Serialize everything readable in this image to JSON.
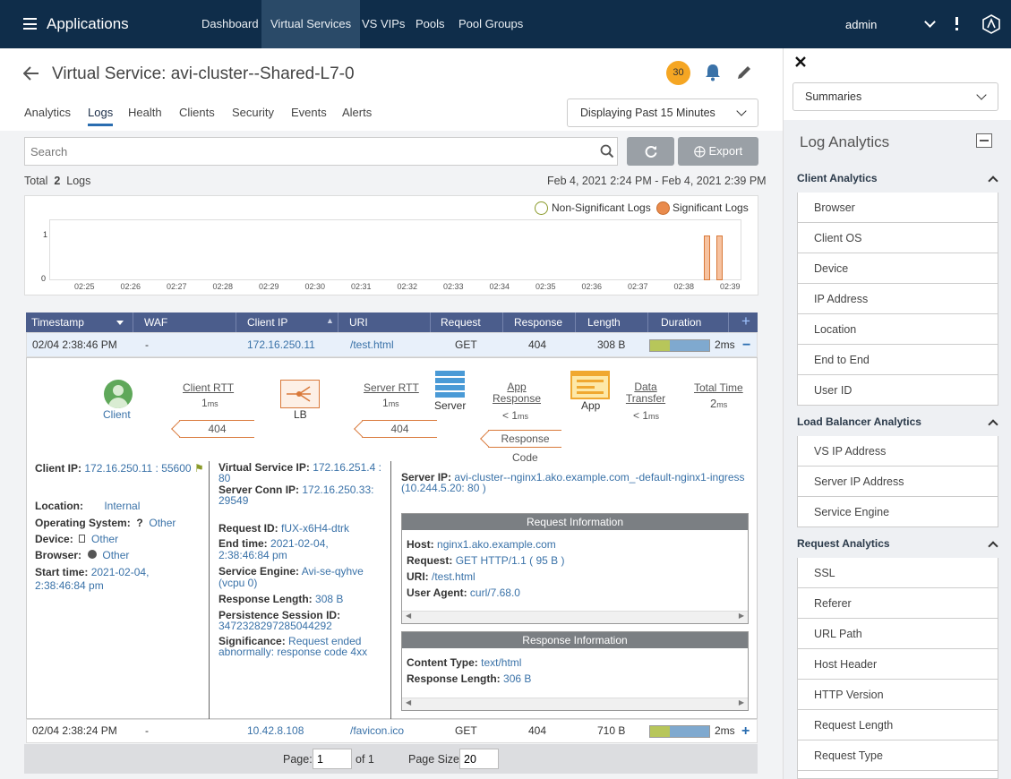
{
  "topbar": {
    "app_title": "Applications",
    "nav": [
      "Dashboard",
      "Virtual Services",
      "VS VIPs",
      "Pools",
      "Pool Groups"
    ],
    "user": "admin"
  },
  "header": {
    "title_prefix": "Virtual Service:",
    "title_name": "avi-cluster--Shared-L7-0",
    "badge_count": "30"
  },
  "tabs": [
    "Analytics",
    "Logs",
    "Health",
    "Clients",
    "Security",
    "Events",
    "Alerts"
  ],
  "time_range": "Displaying Past 15 Minutes",
  "search": {
    "placeholder": "Search"
  },
  "export_label": "Export",
  "summary": {
    "total_label": "Total",
    "count": "2",
    "logs_label": "Logs",
    "range": "Feb 4, 2021 2:24 PM - Feb 4, 2021 2:39 PM"
  },
  "chart": {
    "legend_non": "Non-Significant Logs",
    "legend_sig": "Significant Logs",
    "y_ticks": [
      "1",
      "0"
    ],
    "x_ticks": [
      "02:25",
      "02:26",
      "02:27",
      "02:28",
      "02:29",
      "02:30",
      "02:31",
      "02:32",
      "02:33",
      "02:34",
      "02:35",
      "02:36",
      "02:37",
      "02:38",
      "02:39"
    ]
  },
  "table": {
    "columns": [
      "Timestamp",
      "WAF",
      "Client IP",
      "URI",
      "Request",
      "Response",
      "Length",
      "Duration"
    ],
    "rows": [
      {
        "timestamp": "02/04 2:38:46 PM",
        "waf": "-",
        "client_ip": "172.16.250.11",
        "uri": "/test.html",
        "request": "GET",
        "response": "404",
        "length": "308 B",
        "duration": "2ms"
      },
      {
        "timestamp": "02/04 2:38:24 PM",
        "waf": "-",
        "client_ip": "10.42.8.108",
        "uri": "/favicon.ico",
        "request": "GET",
        "response": "404",
        "length": "710 B",
        "duration": "2ms"
      }
    ]
  },
  "flow": {
    "client": "Client",
    "client_rtt": "Client RTT",
    "client_rtt_val": "1",
    "lb": "LB",
    "server_rtt": "Server RTT",
    "server_rtt_val": "1",
    "server": "Server",
    "app_response": "App Response",
    "app_response_val": "< 1",
    "app": "App",
    "data_transfer": "Data Transfer",
    "data_transfer_val": "< 1",
    "total_time": "Total Time",
    "total_time_val": "2",
    "ms": "ms",
    "code1": "404",
    "code2": "404",
    "response_code_1": "Response",
    "response_code_2": "Code"
  },
  "details": {
    "client_ip_label": "Client IP:",
    "client_ip": "172.16.250.11 : 55600",
    "location_label": "Location:",
    "location": "Internal",
    "os_label": "Operating System:",
    "os_q": "?",
    "os": "Other",
    "device_label": "Device:",
    "device": "Other",
    "browser_label": "Browser:",
    "browser": "Other",
    "start_label": "Start time:",
    "start": "2021-02-04, 2:38:46:84 pm",
    "vs_ip_label": "Virtual Service IP:",
    "vs_ip": "172.16.251.4 : 80",
    "sconn_label": "Server Conn IP:",
    "sconn": "172.16.250.33: 29549",
    "req_id_label": "Request ID:",
    "req_id": "fUX-x6H4-dtrk",
    "end_label": "End time:",
    "end": "2021-02-04, 2:38:46:84 pm",
    "se_label": "Service Engine:",
    "se": "Avi-se-qyhve (vcpu 0)",
    "resp_len_label": "Response Length:",
    "resp_len": "308 B",
    "psid_label": "Persistence Session ID:",
    "psid": "3472328297285044292",
    "sig_label": "Significance:",
    "sig": "Request ended abnormally: response code 4xx",
    "server_ip_label": "Server IP:",
    "server_ip": "avi-cluster--nginx1.ako.example.com_-default-nginx1-ingress (10.244.5.20: 80 )"
  },
  "request_info": {
    "title": "Request Information",
    "host_label": "Host:",
    "host": "nginx1.ako.example.com",
    "request_label": "Request:",
    "request": "GET HTTP/1.1 ( 95 B )",
    "uri_label": "URI:",
    "uri": "/test.html",
    "ua_label": "User Agent:",
    "ua": "curl/7.68.0"
  },
  "response_info": {
    "title": "Response Information",
    "ct_label": "Content Type:",
    "ct": "text/html",
    "rl_label": "Response Length:",
    "rl": "306 B"
  },
  "pagination": {
    "page_label": "Page:",
    "page": "1",
    "of": "of 1",
    "size_label": "Page Size:",
    "size": "20"
  },
  "sidebar": {
    "dropdown": "Summaries",
    "title": "Log Analytics",
    "client_head": "Client Analytics",
    "client_items": [
      "Browser",
      "Client OS",
      "Device",
      "IP Address",
      "Location",
      "End to End",
      "User ID"
    ],
    "lb_head": "Load Balancer Analytics",
    "lb_items": [
      "VS IP Address",
      "Server IP Address",
      "Service Engine"
    ],
    "req_head": "Request Analytics",
    "req_items": [
      "SSL",
      "Referer",
      "URL Path",
      "Host Header",
      "HTTP Version",
      "Request Length",
      "Request Type"
    ]
  },
  "colors": {
    "navbar": "#0f2d4a",
    "table_header": "#4b5d8c",
    "accent": "#2a6db0",
    "significant": "#e98b4d",
    "badge": "#f5a623"
  }
}
